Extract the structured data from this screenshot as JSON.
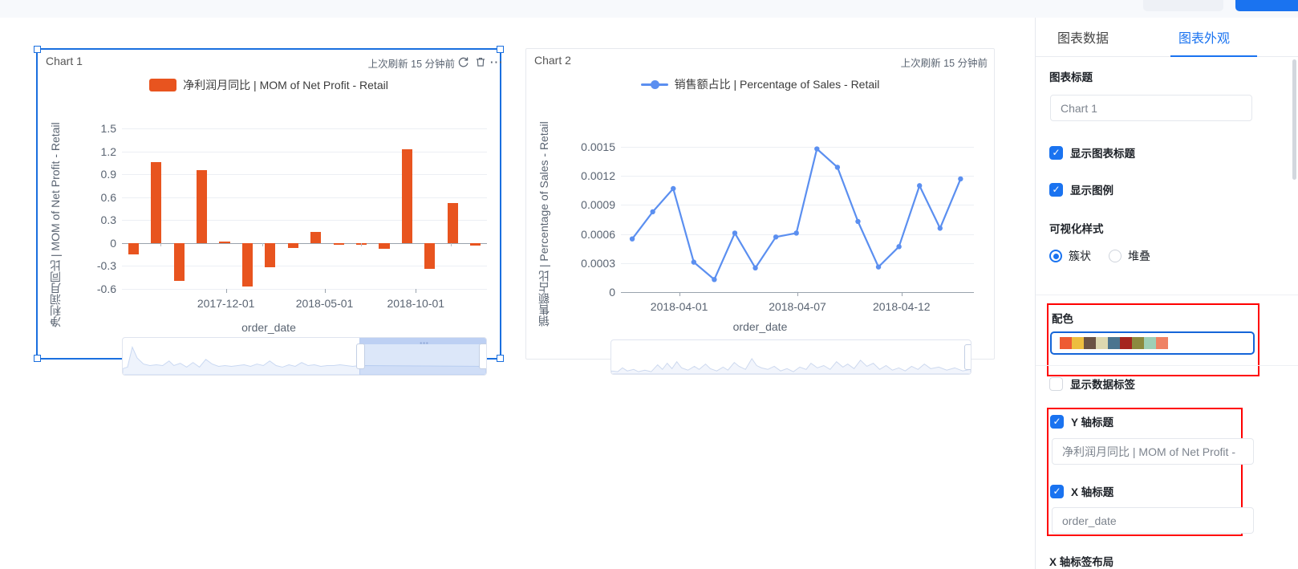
{
  "top_bar": {
    "ghost_button_label": "",
    "primary_button_label": ""
  },
  "charts": [
    {
      "id": "chart-1",
      "title": "Chart 1",
      "refresh_text": "上次刷新 15 分钟前",
      "selected": true,
      "icons": {
        "refresh": "refresh-icon",
        "delete": "trash-icon",
        "more": "more-options-icon"
      },
      "legend_label": "净利润月同比 | MOM of Net Profit - Retail",
      "color": "#e8541f",
      "y_axis_title": "净利润月同比 | MOM of Net Profit - Retail",
      "x_axis_title": "order_date"
    },
    {
      "id": "chart-2",
      "title": "Chart 2",
      "refresh_text": "上次刷新 15 分钟前",
      "selected": false,
      "legend_label": "销售额占比 | Percentage of Sales - Retail",
      "color": "#5b8ff0",
      "y_axis_title": "销售额占比 | Percentage of Sales - Retail",
      "x_axis_title": "order_date"
    }
  ],
  "chart_data": [
    {
      "type": "bar",
      "title": "Chart 1",
      "series_name": "净利润月同比 | MOM of Net Profit - Retail",
      "color": "#e8541f",
      "xlabel": "order_date",
      "ylabel": "净利润月同比 | MOM of Net Profit - Retail",
      "yticks": [
        1.5,
        1.2,
        0.9,
        0.6,
        0.3,
        0,
        -0.3,
        -0.6
      ],
      "ylim": [
        -0.6,
        1.5
      ],
      "xticks": [
        "2017-12-01",
        "2018-05-01",
        "2018-10-01"
      ],
      "xtick_positions": [
        0.285,
        0.555,
        0.805
      ],
      "values": [
        -0.15,
        1.06,
        -0.5,
        0.95,
        0.02,
        -0.57,
        -0.32,
        -0.06,
        0.15,
        -0.02,
        -0.02,
        -0.08,
        1.23,
        -0.34,
        0.52,
        -0.03
      ],
      "grid": true,
      "legend_position": "top-center"
    },
    {
      "type": "line",
      "title": "Chart 2",
      "series_name": "销售额占比 | Percentage of Sales - Retail",
      "color": "#5b8ff0",
      "xlabel": "order_date",
      "ylabel": "销售额占比 | Percentage of Sales - Retail",
      "yticks": [
        0.0015,
        0.0012,
        0.0009,
        0.0006,
        0.0003,
        0
      ],
      "ylim": [
        0,
        0.0017
      ],
      "xticks": [
        "2018-04-01",
        "2018-04-07",
        "2018-04-12"
      ],
      "xtick_positions": [
        0.165,
        0.5,
        0.795
      ],
      "values": [
        0.00055,
        0.00083,
        0.00107,
        0.00031,
        0.00013,
        0.00061,
        0.00025,
        0.00057,
        0.00061,
        0.00148,
        0.00129,
        0.00073,
        0.00026,
        0.00047,
        0.0011,
        0.00066,
        0.00117
      ],
      "grid": true,
      "legend_position": "top-center",
      "markers": true
    }
  ],
  "panel": {
    "tabs": [
      {
        "label": "图表数据",
        "active": false
      },
      {
        "label": "图表外观",
        "active": true
      }
    ],
    "chart_title_section": {
      "heading": "图表标题",
      "input_value": "Chart 1"
    },
    "show_chart_title": {
      "label": "显示图表标题",
      "checked": true
    },
    "show_legend": {
      "label": "显示图例",
      "checked": true
    },
    "visualization_style": {
      "heading": "可视化样式",
      "options": [
        {
          "label": "簇状",
          "selected": true
        },
        {
          "label": "堆叠",
          "selected": false
        }
      ]
    },
    "color_scheme": {
      "heading": "配色",
      "swatches": [
        "#ee5b33",
        "#edbe3f",
        "#6b5344",
        "#ddd8b0",
        "#4b748f",
        "#a5251f",
        "#8c8a3f",
        "#9ecfb6",
        "#ef8264"
      ],
      "highlighted": true
    },
    "show_data_labels": {
      "label": "显示数据标签",
      "checked": false
    },
    "y_axis_title": {
      "label": "Y 轴标题",
      "checked": true,
      "input_value": "净利润月同比 | MOM of Net Profit -"
    },
    "x_axis_title": {
      "label": "X 轴标题",
      "checked": true,
      "input_value": "order_date"
    },
    "x_axis_label_layout": {
      "heading": "X 轴标签布局"
    }
  }
}
